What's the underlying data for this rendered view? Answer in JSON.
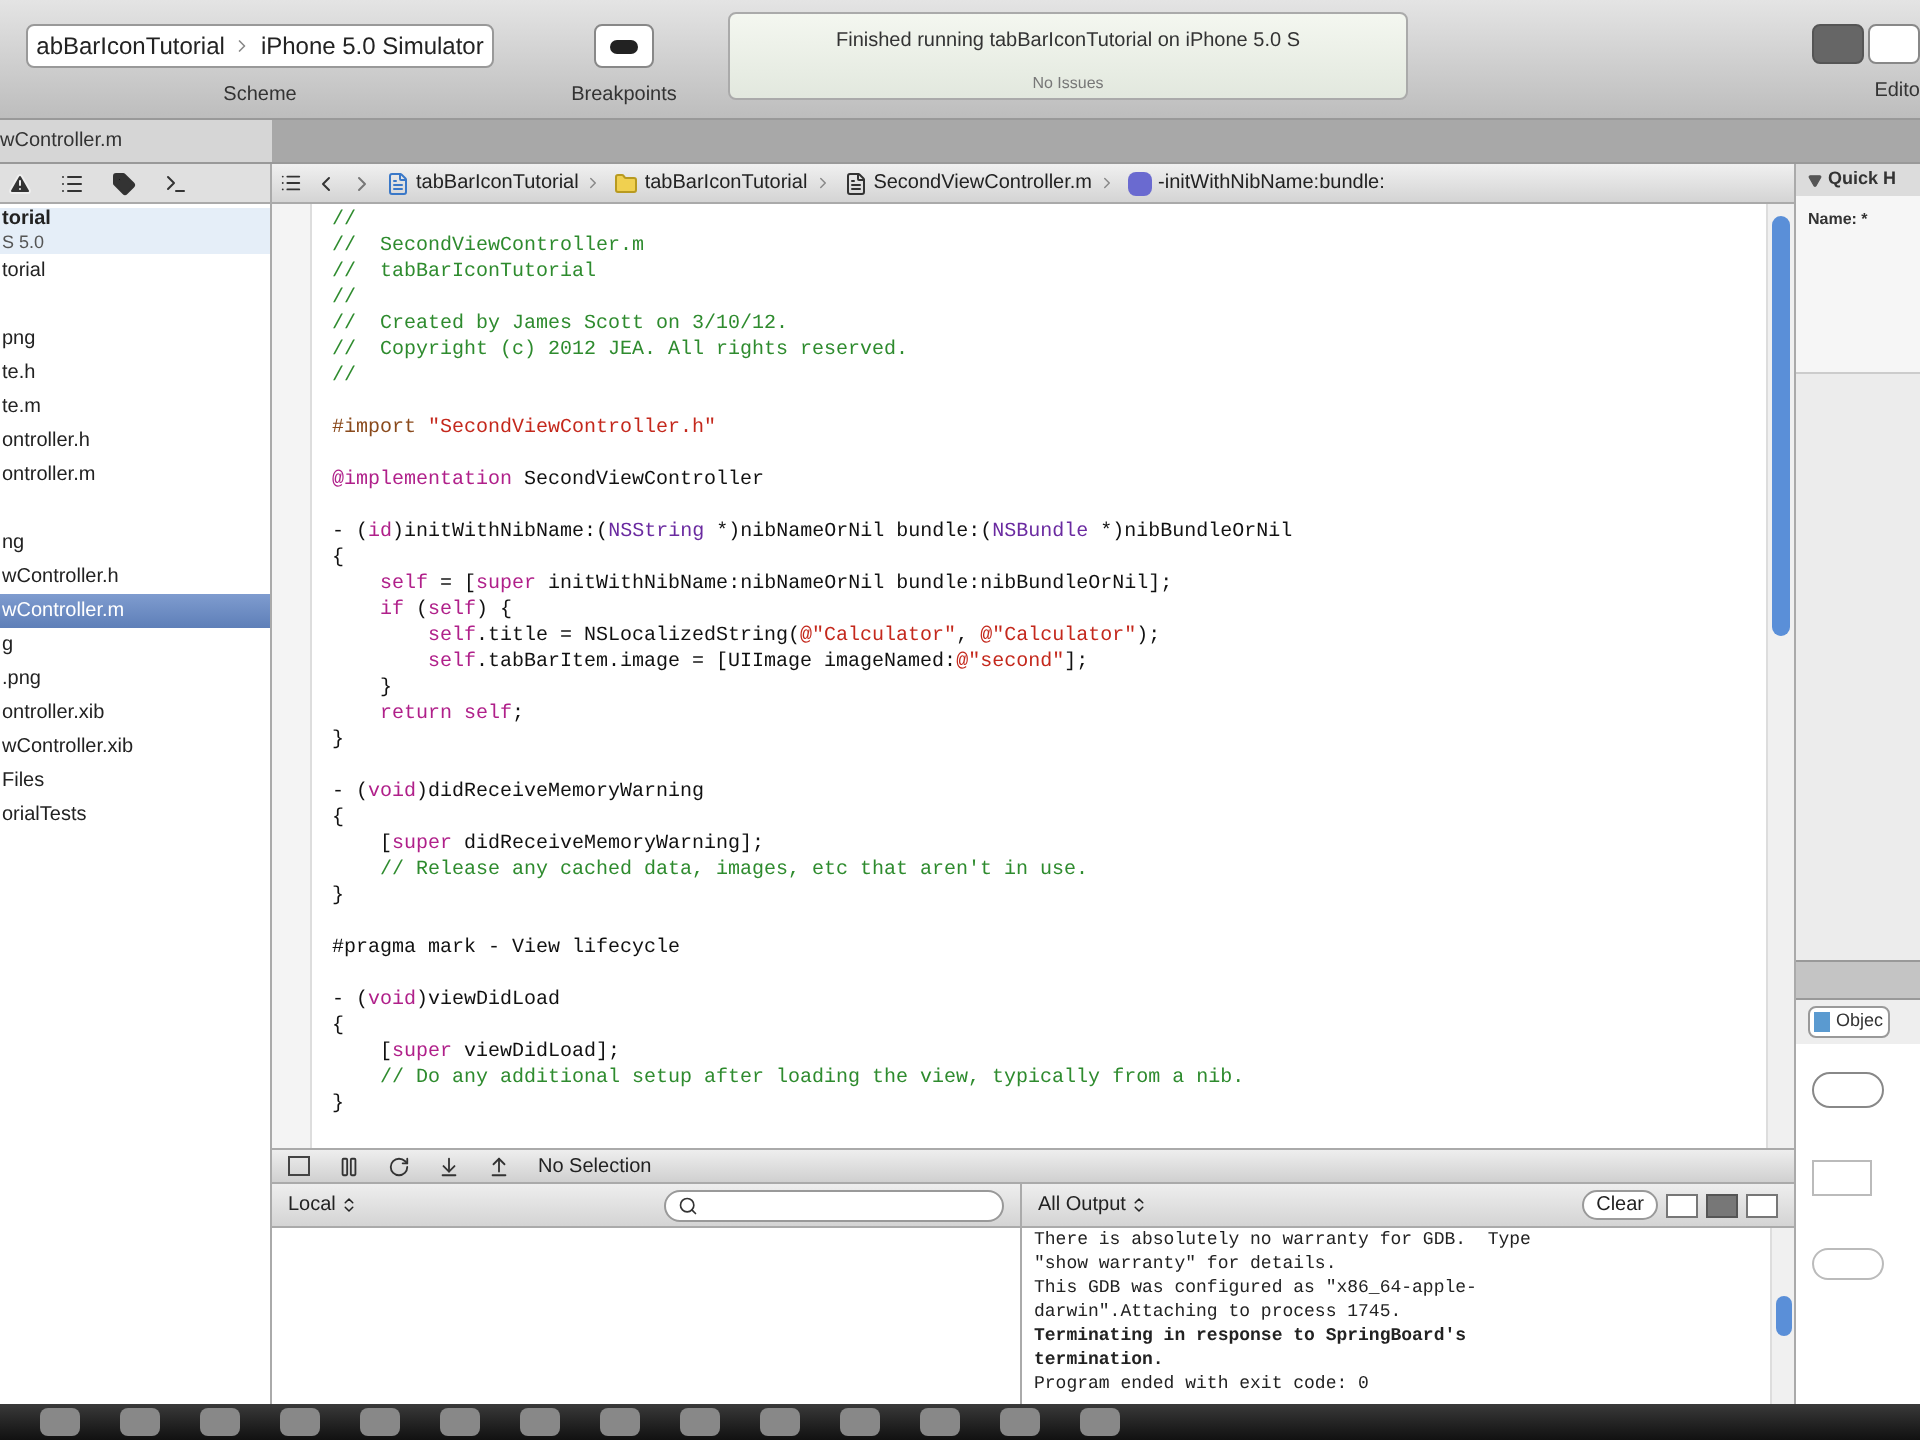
{
  "toolbar": {
    "scheme_target": "abBarIconTutorial",
    "scheme_device": "iPhone 5.0 Simulator",
    "scheme_label": "Scheme",
    "breakpoints_label": "Breakpoints",
    "activity_title": "Finished running tabBarIconTutorial on iPhone 5.0 S",
    "activity_issues": "No Issues",
    "editor_label": "Edito"
  },
  "tab": {
    "title": "wController.m"
  },
  "navigator": {
    "groups": [
      [
        {
          "label": "torial",
          "sublabel": "S 5.0",
          "selected": false,
          "project": true
        },
        {
          "label": "torial",
          "selected": false,
          "project": false
        }
      ],
      [
        {
          "label": "png",
          "selected": false,
          "project": false
        },
        {
          "label": "te.h",
          "selected": false,
          "project": false
        },
        {
          "label": "te.m",
          "selected": false,
          "project": false
        },
        {
          "label": "ontroller.h",
          "selected": false,
          "project": false
        },
        {
          "label": "ontroller.m",
          "selected": false,
          "project": false
        }
      ],
      [
        {
          "label": "ng",
          "selected": false,
          "project": false
        },
        {
          "label": "wController.h",
          "selected": false,
          "project": false
        },
        {
          "label": "wController.m",
          "selected": true,
          "project": false
        },
        {
          "label": "g",
          "selected": false,
          "project": false
        },
        {
          "label": ".png",
          "selected": false,
          "project": false
        },
        {
          "label": "ontroller.xib",
          "selected": false,
          "project": false
        },
        {
          "label": "wController.xib",
          "selected": false,
          "project": false
        },
        {
          "label": "Files",
          "selected": false,
          "project": false
        },
        {
          "label": "orialTests",
          "selected": false,
          "project": false
        }
      ]
    ]
  },
  "jump_bar": [
    "tabBarIconTutorial",
    "tabBarIconTutorial",
    "SecondViewController.m",
    "-initWithNibName:bundle:"
  ],
  "code_blocks": [
    [
      [
        {
          "kind": "comment",
          "text": "//"
        }
      ],
      [
        {
          "kind": "comment",
          "text": "//  SecondViewController.m"
        }
      ],
      [
        {
          "kind": "comment",
          "text": "//  tabBarIconTutorial"
        }
      ],
      [
        {
          "kind": "comment",
          "text": "//"
        }
      ],
      [
        {
          "kind": "comment",
          "text": "//  Created by James Scott on 3/10/12."
        }
      ],
      [
        {
          "kind": "comment",
          "text": "//  Copyright (c) 2012 JEA. All rights reserved."
        }
      ],
      [
        {
          "kind": "comment",
          "text": "//"
        }
      ]
    ],
    [
      [
        {
          "kind": "directive",
          "text": "#import "
        },
        {
          "kind": "string",
          "text": "\"SecondViewController.h\""
        }
      ]
    ],
    [
      [
        {
          "kind": "keyword",
          "text": "@implementation"
        },
        {
          "kind": "plain",
          "text": " SecondViewController"
        }
      ]
    ],
    [
      [
        {
          "kind": "plain",
          "text": "- ("
        },
        {
          "kind": "keyword",
          "text": "id"
        },
        {
          "kind": "plain",
          "text": ")initWithNibName:("
        },
        {
          "kind": "type",
          "text": "NSString"
        },
        {
          "kind": "plain",
          "text": " *)nibNameOrNil bundle:("
        },
        {
          "kind": "type",
          "text": "NSBundle"
        },
        {
          "kind": "plain",
          "text": " *)nibBundleOrNil"
        }
      ],
      [
        {
          "kind": "plain",
          "text": "{"
        }
      ],
      [
        {
          "kind": "keyword",
          "text": "    self"
        },
        {
          "kind": "plain",
          "text": " = ["
        },
        {
          "kind": "keyword",
          "text": "super"
        },
        {
          "kind": "plain",
          "text": " initWithNibName:nibNameOrNil bundle:nibBundleOrNil];"
        }
      ],
      [
        {
          "kind": "keyword",
          "text": "    if"
        },
        {
          "kind": "plain",
          "text": " ("
        },
        {
          "kind": "keyword",
          "text": "self"
        },
        {
          "kind": "plain",
          "text": ") {"
        }
      ],
      [
        {
          "kind": "keyword",
          "text": "        self"
        },
        {
          "kind": "plain",
          "text": ".title = NSLocalizedString("
        },
        {
          "kind": "string",
          "text": "@\"Calculator\""
        },
        {
          "kind": "plain",
          "text": ", "
        },
        {
          "kind": "string",
          "text": "@\"Calculator\""
        },
        {
          "kind": "plain",
          "text": ");"
        }
      ],
      [
        {
          "kind": "keyword",
          "text": "        self"
        },
        {
          "kind": "plain",
          "text": ".tabBarItem.image = [UIImage imageNamed:"
        },
        {
          "kind": "string",
          "text": "@\"second\""
        },
        {
          "kind": "plain",
          "text": "];"
        }
      ],
      [
        {
          "kind": "plain",
          "text": "    }"
        }
      ],
      [
        {
          "kind": "keyword",
          "text": "    return self"
        },
        {
          "kind": "plain",
          "text": ";"
        }
      ],
      [
        {
          "kind": "plain",
          "text": "}"
        }
      ]
    ],
    [
      [
        {
          "kind": "plain",
          "text": "- ("
        },
        {
          "kind": "keyword",
          "text": "void"
        },
        {
          "kind": "plain",
          "text": ")didReceiveMemoryWarning"
        }
      ],
      [
        {
          "kind": "plain",
          "text": "{"
        }
      ],
      [
        {
          "kind": "plain",
          "text": "    ["
        },
        {
          "kind": "keyword",
          "text": "super"
        },
        {
          "kind": "plain",
          "text": " didReceiveMemoryWarning];"
        }
      ],
      [
        {
          "kind": "comment",
          "text": "    // Release any cached data, images, etc that aren't in use."
        }
      ],
      [
        {
          "kind": "plain",
          "text": "}"
        }
      ]
    ],
    [
      [
        {
          "kind": "plain",
          "text": "#pragma mark - View lifecycle"
        }
      ]
    ],
    [
      [
        {
          "kind": "plain",
          "text": "- ("
        },
        {
          "kind": "keyword",
          "text": "void"
        },
        {
          "kind": "plain",
          "text": ")viewDidLoad"
        }
      ],
      [
        {
          "kind": "plain",
          "text": "{"
        }
      ],
      [
        {
          "kind": "plain",
          "text": "    ["
        },
        {
          "kind": "keyword",
          "text": "super"
        },
        {
          "kind": "plain",
          "text": " viewDidLoad];"
        }
      ],
      [
        {
          "kind": "comment",
          "text": "    // Do any additional setup after loading the view, typically from a nib."
        }
      ],
      [
        {
          "kind": "plain",
          "text": "}"
        }
      ]
    ]
  ],
  "debug_bar": {
    "selection": "No Selection"
  },
  "variables": {
    "scope": "Local"
  },
  "console": {
    "filter": "All Output",
    "clear": "Clear",
    "lines": [
      {
        "text": "There is absolutely no warranty for GDB.  Type",
        "bold": false
      },
      {
        "text": "\"show warranty\" for details.",
        "bold": false
      },
      {
        "text": "This GDB was configured as \"x86_64-apple-",
        "bold": false
      },
      {
        "text": "darwin\".Attaching to process 1745.",
        "bold": false
      },
      {
        "text": "Terminating in response to SpringBoard's",
        "bold": true
      },
      {
        "text": "termination.",
        "bold": true
      },
      {
        "text": "Program ended with exit code: 0",
        "bold": false
      }
    ]
  },
  "utilities": {
    "quick_help_title": "Quick H",
    "name_label": "Name: *",
    "library_tab": "Objec"
  }
}
